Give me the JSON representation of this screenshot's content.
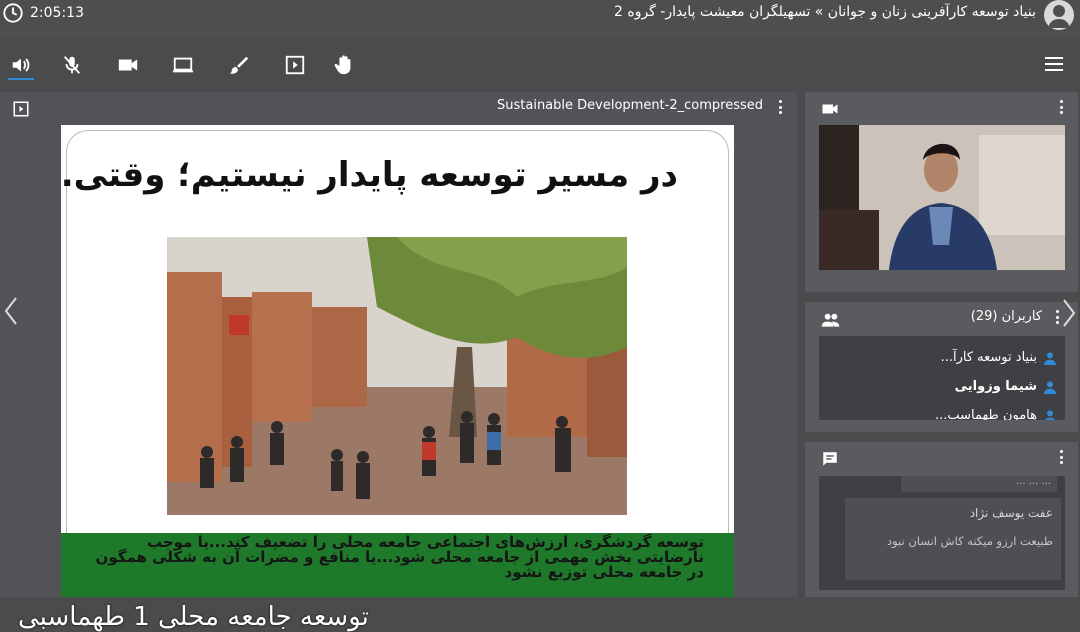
{
  "header": {
    "time": "2:05:13",
    "title": "بنیاد توسعه کارآفرینی زنان و جوانان » تسهیلگران معیشت پایدار- گروه 2"
  },
  "toolbar": {
    "icons": [
      "speaker-icon",
      "mic-muted-icon",
      "camera-icon",
      "screen-share-icon",
      "brush-icon",
      "presentation-icon",
      "raise-hand-icon",
      "menu-icon"
    ],
    "accent": "#2f8bd6"
  },
  "presentation": {
    "file_name": "Sustainable Development-2_compressed",
    "heading": "در مسیر توسعه پایدار نیستیم؛ وقتی...",
    "body_text": "توسعه گردشگری، ارزش‌های اجتماعی جامعه محلی را تضعیف کند...یا موجب نارضایتی بخش مهمی از جامعه محلی شود...یا منافع و مضرات آن به شکلی همگون در جامعه محلی توزیع نشود",
    "caption_overlay": "توسعه جامعه محلی 1 طهماسبی"
  },
  "users": {
    "title": "کاربران (29)",
    "list": [
      {
        "name": "بنیاد توسعه کارآ...",
        "bold": false
      },
      {
        "name": "شیما وزوایی",
        "bold": true
      },
      {
        "name": "هامون طهماسب...",
        "bold": false
      }
    ]
  },
  "chat": {
    "top_partial": "... ... ...",
    "sender": "عفت یوسف نژاد",
    "message": "طبیعت ارزو میکنه کاش انسان نبود"
  }
}
